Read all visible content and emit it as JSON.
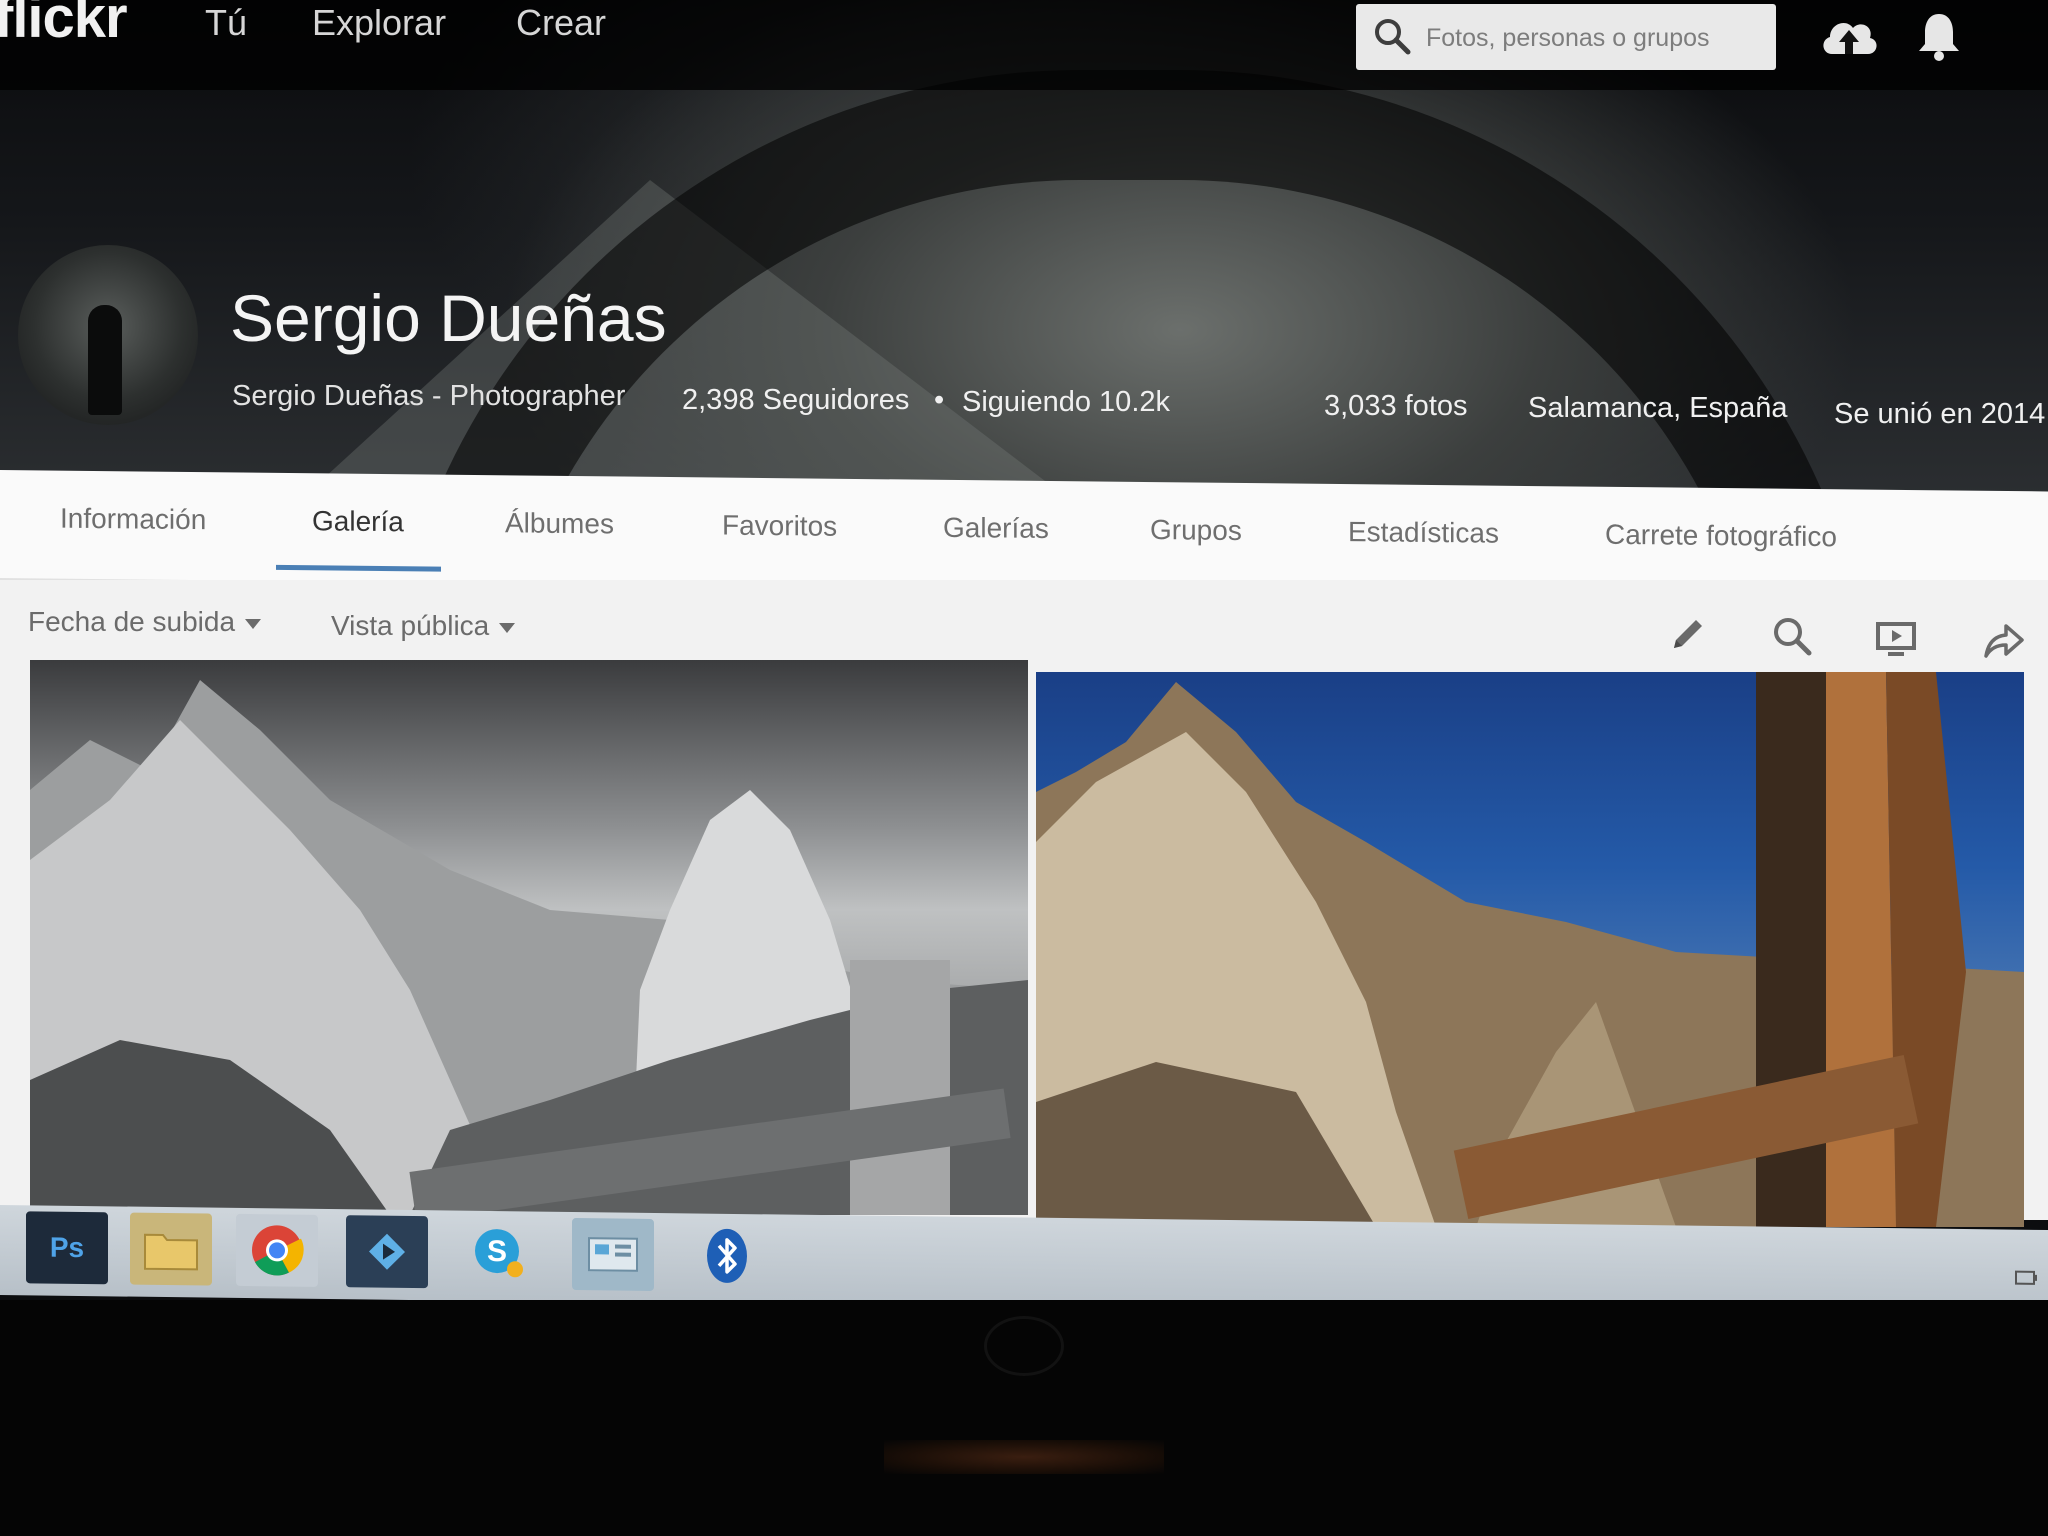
{
  "app": {
    "logo": "flickr"
  },
  "topnav": {
    "links": [
      "Tú",
      "Explorar",
      "Crear"
    ],
    "search_placeholder": "Fotos, personas o grupos"
  },
  "profile": {
    "name": "Sergio Dueñas",
    "subtitle": "Sergio Dueñas - Photographer",
    "followers": "2,398 Seguidores",
    "separator": "•",
    "following": "Siguiendo 10.2k",
    "photos": "3,033 fotos",
    "location": "Salamanca, España",
    "joined": "Se unió en 2014"
  },
  "tabs": [
    {
      "label": "Información"
    },
    {
      "label": "Galería",
      "active": true
    },
    {
      "label": "Álbumes"
    },
    {
      "label": "Favoritos"
    },
    {
      "label": "Galerías"
    },
    {
      "label": "Grupos"
    },
    {
      "label": "Estadísticas"
    },
    {
      "label": "Carrete fotográfico"
    }
  ],
  "toolbar": {
    "sort_label": "Fecha de subida",
    "view_label": "Vista pública",
    "icons": [
      "pencil-icon",
      "search-icon",
      "slideshow-icon",
      "share-icon"
    ]
  },
  "taskbar": {
    "ps_label": "Ps",
    "apps": [
      "photoshop-icon",
      "file-explorer-icon",
      "chrome-icon",
      "media-player-icon",
      "skype-icon",
      "control-panel-icon",
      "bluetooth-icon"
    ]
  },
  "colors": {
    "accent": "#4a7fb5",
    "tab_bar": "#fafafa",
    "toolbar": "#f2f2f2"
  }
}
